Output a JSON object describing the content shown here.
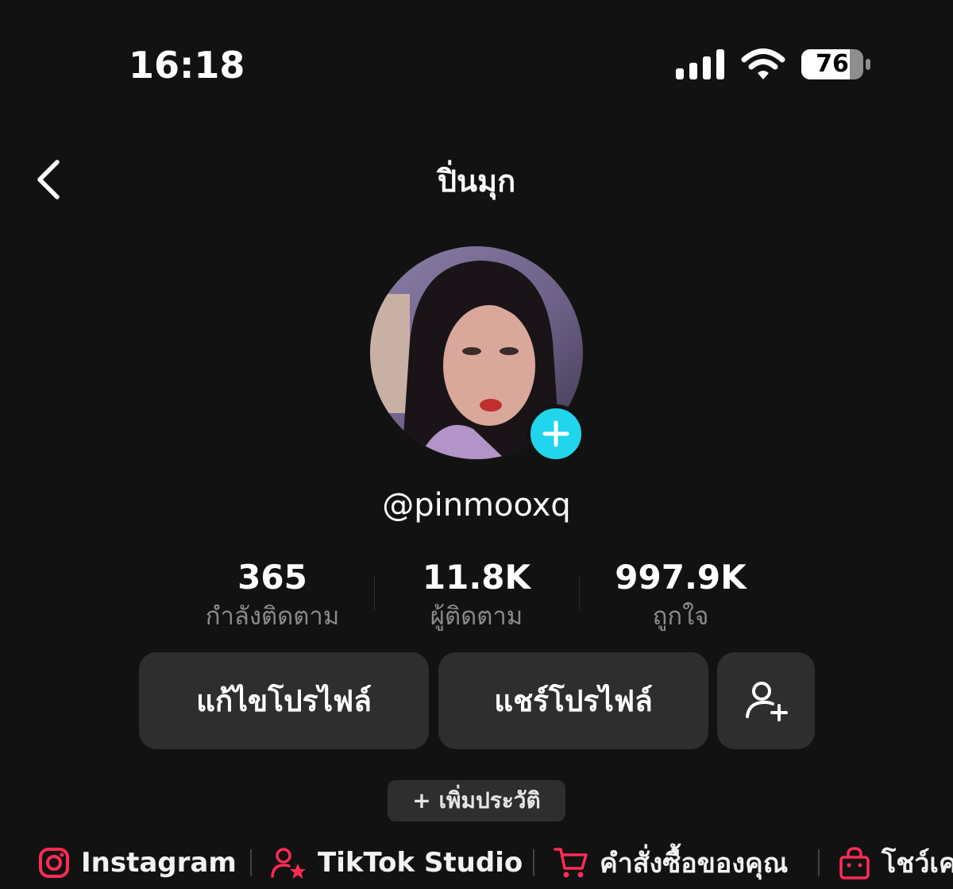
{
  "status_bar": {
    "time": "16:18",
    "battery": "76"
  },
  "header": {
    "title": "ปิ่นมุก"
  },
  "profile": {
    "username": "@pinmooxq"
  },
  "stats": [
    {
      "value": "365",
      "label": "กำลังติดตาม"
    },
    {
      "value": "11.8K",
      "label": "ผู้ติดตาม"
    },
    {
      "value": "997.9K",
      "label": "ถูกใจ"
    }
  ],
  "buttons": {
    "edit_profile": "แก้ไขโปรไฟล์",
    "share_profile": "แชร์โปรไฟล์"
  },
  "bio": {
    "add_label": "+ เพิ่มประวัติ"
  },
  "links": [
    {
      "label": "Instagram",
      "icon": "instagram-icon"
    },
    {
      "label": "TikTok Studio",
      "icon": "creator-star-icon"
    },
    {
      "label": "คำสั่งซื้อของคุณ",
      "icon": "cart-icon"
    },
    {
      "label": "โชว์เค",
      "icon": "shop-bag-icon"
    }
  ],
  "colors": {
    "background": "#121212",
    "accent": "#20d5ec",
    "link_icon": "#fe2c55",
    "button_bg": "#2e2e2e",
    "secondary_text": "#8a8a8a"
  }
}
